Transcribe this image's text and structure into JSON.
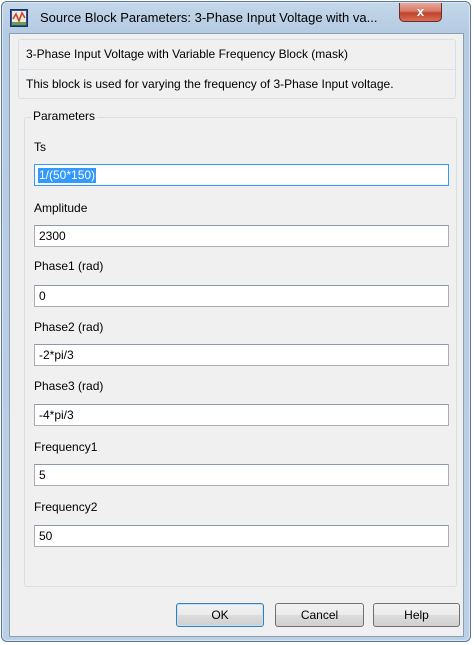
{
  "window": {
    "title": "Source Block Parameters: 3-Phase Input Voltage with va...",
    "close_label": "x"
  },
  "description": {
    "title": "3-Phase Input Voltage with Variable Frequency Block  (mask)",
    "text": "This block is used for varying the frequency of 3-Phase Input voltage."
  },
  "parameters": {
    "group_label": "Parameters",
    "fields": [
      {
        "label": "Ts",
        "value": "1/(50*150)",
        "selected": true
      },
      {
        "label": "Amplitude",
        "value": "2300"
      },
      {
        "label": "Phase1 (rad)",
        "value": "0"
      },
      {
        "label": "Phase2 (rad)",
        "value": "-2*pi/3"
      },
      {
        "label": "Phase3 (rad)",
        "value": "-4*pi/3"
      },
      {
        "label": "Frequency1",
        "value": "5"
      },
      {
        "label": "Frequency2",
        "value": "50"
      }
    ]
  },
  "buttons": {
    "ok": "OK",
    "cancel": "Cancel",
    "help": "Help"
  },
  "colors": {
    "titlebar": "#b5cbe2",
    "close_button": "#c2412a",
    "selection": "#3399ff",
    "dialog_background": "#f0f0f0"
  },
  "icons": {
    "app": "simulink-block-icon",
    "close": "close-icon"
  }
}
